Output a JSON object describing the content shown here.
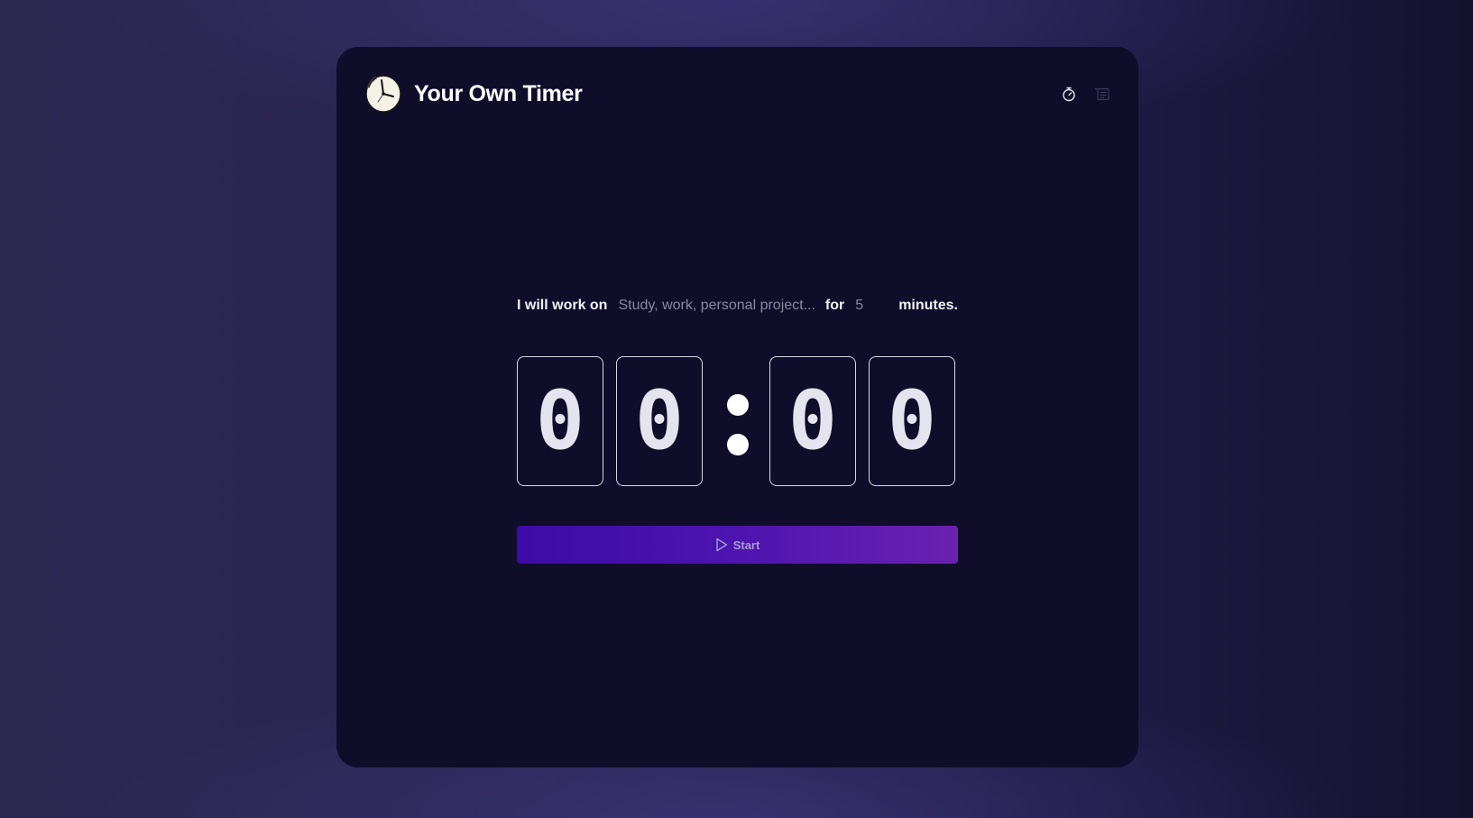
{
  "app": {
    "title": "Your Own Timer",
    "logo_icon": "clock-icon"
  },
  "header": {
    "actions": [
      {
        "name": "stopwatch-icon"
      },
      {
        "name": "task-list-icon"
      }
    ]
  },
  "sentence": {
    "prefix": "I will work on",
    "task_placeholder": "Study, work, personal project...",
    "task_value": "",
    "for_label": "for",
    "minutes_placeholder": "5",
    "minutes_value": "",
    "suffix": "minutes."
  },
  "timer": {
    "digits": [
      "0",
      "0",
      "0",
      "0"
    ],
    "separator": ":"
  },
  "start_button": {
    "label": "Start",
    "icon": "play-icon"
  },
  "colors": {
    "card_background": "#0f0d2a",
    "button_gradient_start": "#3e0aa8",
    "button_gradient_end": "#6a22b0",
    "digit_border": "#d9d7e6"
  }
}
